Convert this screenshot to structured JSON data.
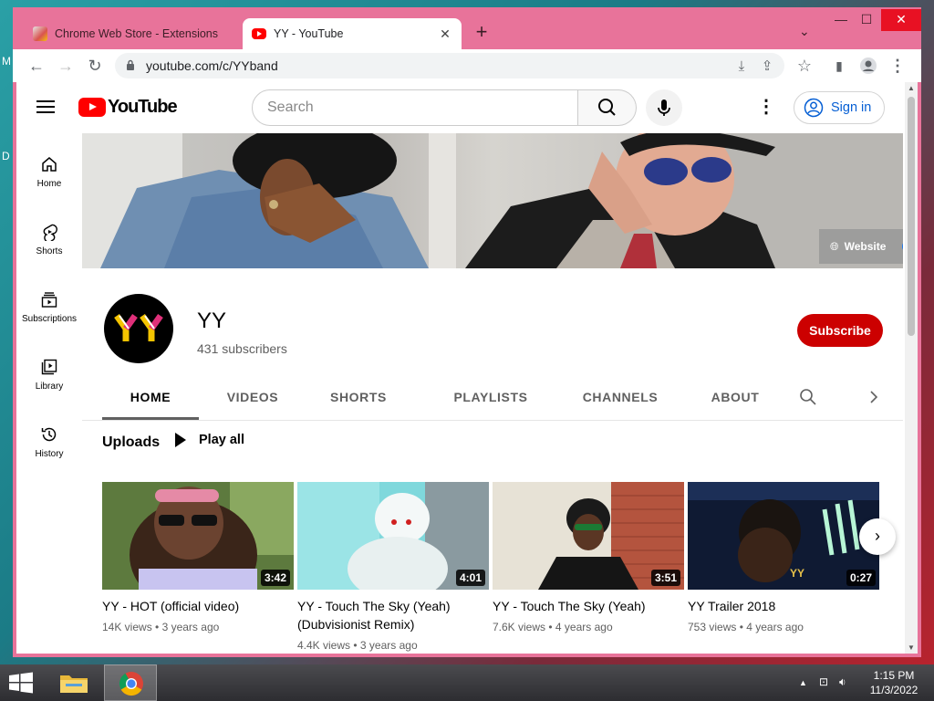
{
  "desktop": {
    "text_1": "M",
    "text_2": "D"
  },
  "browser": {
    "tabs": [
      {
        "title": "Chrome Web Store - Extensions",
        "favicon": "chrome-web-store-icon"
      },
      {
        "title": "YY - YouTube",
        "favicon": "youtube-icon"
      }
    ],
    "new_tab": "+",
    "url": "youtube.com/c/YYband",
    "window_controls": {
      "minimize": "—",
      "maximize": "☐",
      "close": "✕"
    }
  },
  "youtube": {
    "logo_text": "YouTube",
    "search_placeholder": "Search",
    "sign_in": "Sign in",
    "guide": [
      {
        "label": "Home",
        "icon": "home-icon"
      },
      {
        "label": "Shorts",
        "icon": "shorts-icon"
      },
      {
        "label": "Subscriptions",
        "icon": "subscriptions-icon"
      },
      {
        "label": "Library",
        "icon": "library-icon"
      },
      {
        "label": "History",
        "icon": "history-icon"
      }
    ],
    "banner_links": {
      "website": "Website"
    },
    "channel": {
      "name": "YY",
      "subscribers": "431 subscribers",
      "subscribe": "Subscribe"
    },
    "channel_tabs": [
      "HOME",
      "VIDEOS",
      "SHORTS",
      "PLAYLISTS",
      "CHANNELS",
      "ABOUT"
    ],
    "section": {
      "title": "Uploads",
      "play_all": "Play all"
    },
    "videos": [
      {
        "title": "YY - HOT (official video)",
        "duration": "3:42",
        "views": "14K views",
        "age": "3 years ago"
      },
      {
        "title": "YY - Touch The Sky (Yeah) (Dubvisionist Remix)",
        "duration": "4:01",
        "views": "4.4K views",
        "age": "3 years ago"
      },
      {
        "title": "YY - Touch The Sky (Yeah)",
        "duration": "3:51",
        "views": "7.6K views",
        "age": "4 years ago"
      },
      {
        "title": "YY Trailer 2018",
        "duration": "0:27",
        "views": "753 views",
        "age": "4 years ago"
      }
    ],
    "video_meta_separator": " • ",
    "trailer_overlay": "YY"
  },
  "taskbar": {
    "time": "1:15 PM",
    "date": "11/3/2022"
  },
  "colors": {
    "accent": "#cc0000",
    "link": "#065fd4",
    "tab_strip": "#e8739a"
  }
}
